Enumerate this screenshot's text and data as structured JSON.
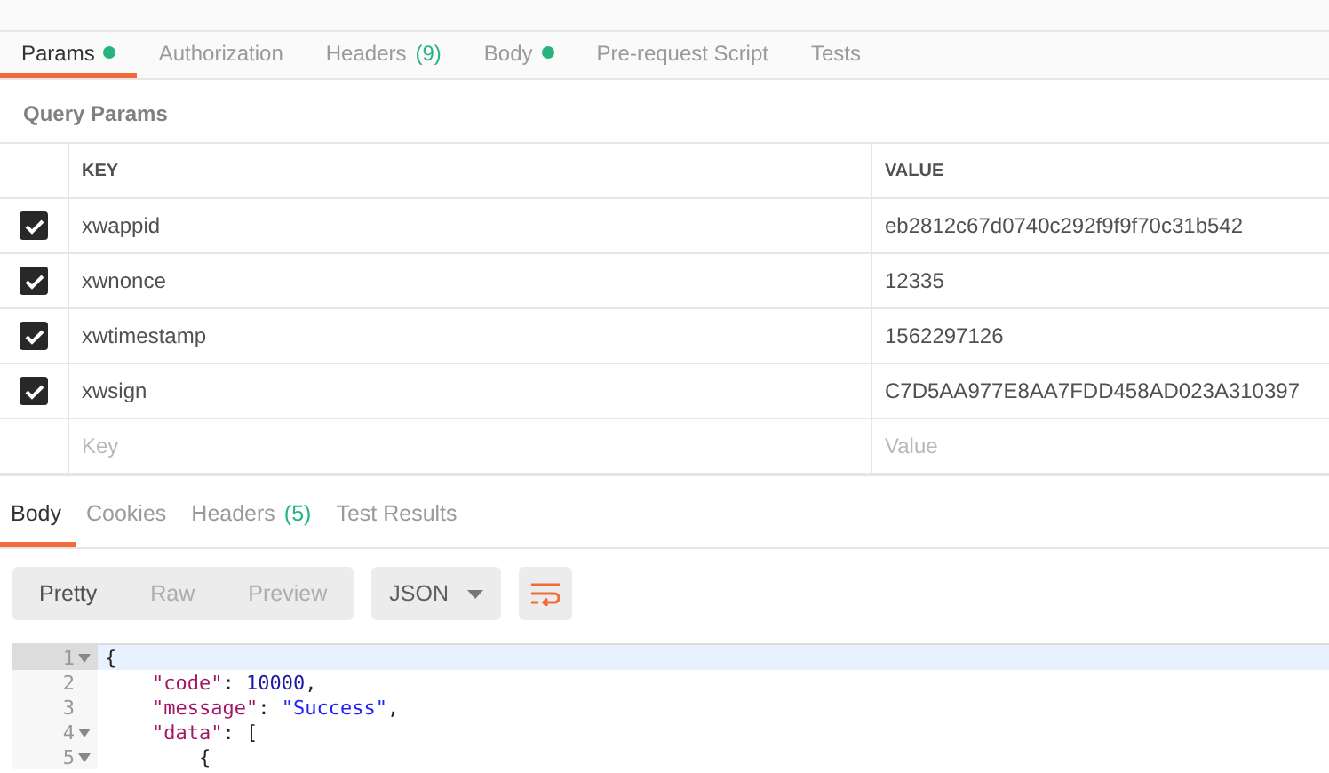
{
  "request_tabs": [
    {
      "label": "Params",
      "selected": true,
      "dot": true
    },
    {
      "label": "Authorization",
      "selected": false,
      "dot": false
    },
    {
      "label": "Headers",
      "count": "(9)",
      "selected": false,
      "dot": false
    },
    {
      "label": "Body",
      "selected": false,
      "dot": true
    },
    {
      "label": "Pre-request Script",
      "selected": false,
      "dot": false
    },
    {
      "label": "Tests",
      "selected": false,
      "dot": false
    }
  ],
  "query_params": {
    "title": "Query Params",
    "columns": [
      "KEY",
      "VALUE"
    ],
    "rows": [
      {
        "checked": true,
        "key": "xwappid",
        "value": "eb2812c67d0740c292f9f9f70c31b542"
      },
      {
        "checked": true,
        "key": "xwnonce",
        "value": "12335"
      },
      {
        "checked": true,
        "key": "xwtimestamp",
        "value": "1562297126"
      },
      {
        "checked": true,
        "key": "xwsign",
        "value": "C7D5AA977E8AA7FDD458AD023A310397"
      }
    ],
    "new_row": {
      "key_placeholder": "Key",
      "value_placeholder": "Value"
    }
  },
  "response_tabs": [
    {
      "label": "Body",
      "selected": true
    },
    {
      "label": "Cookies",
      "selected": false
    },
    {
      "label": "Headers",
      "count": "(5)",
      "selected": false
    },
    {
      "label": "Test Results",
      "selected": false
    }
  ],
  "view_modes": [
    {
      "label": "Pretty",
      "selected": true
    },
    {
      "label": "Raw",
      "selected": false
    },
    {
      "label": "Preview",
      "selected": false
    }
  ],
  "format": "JSON",
  "code_lines": [
    {
      "number": "1",
      "fold": true,
      "highlighted": true,
      "tokens": [
        {
          "kind": "punct",
          "text": "{"
        }
      ]
    },
    {
      "number": "2",
      "fold": false,
      "highlighted": false,
      "tokens": [
        {
          "kind": "key",
          "text": "    \"code\""
        },
        {
          "kind": "punct",
          "text": ": "
        },
        {
          "kind": "number",
          "text": "10000"
        },
        {
          "kind": "punct",
          "text": ","
        }
      ]
    },
    {
      "number": "3",
      "fold": false,
      "highlighted": false,
      "tokens": [
        {
          "kind": "key",
          "text": "    \"message\""
        },
        {
          "kind": "punct",
          "text": ": "
        },
        {
          "kind": "string",
          "text": "\"Success\""
        },
        {
          "kind": "punct",
          "text": ","
        }
      ]
    },
    {
      "number": "4",
      "fold": true,
      "highlighted": false,
      "tokens": [
        {
          "kind": "key",
          "text": "    \"data\""
        },
        {
          "kind": "punct",
          "text": ": ["
        }
      ]
    },
    {
      "number": "5",
      "fold": true,
      "highlighted": false,
      "tokens": [
        {
          "kind": "punct",
          "text": "        {"
        }
      ]
    }
  ]
}
